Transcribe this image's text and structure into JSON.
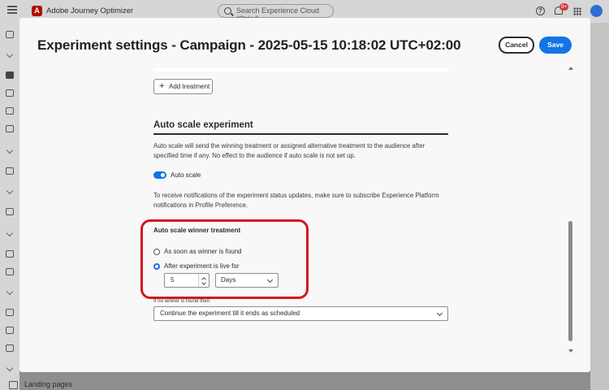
{
  "app": {
    "name": "Adobe Journey Optimizer",
    "logo_letter": "A"
  },
  "search": {
    "placeholder": "Search Experience Cloud (Ctrl+/)"
  },
  "header": {
    "help_glyph": "?",
    "notification_badge": "9+"
  },
  "sidebar": {
    "bottom_item_label": "Landing pages"
  },
  "modal": {
    "title": "Experiment settings - Campaign - 2025-05-15 10:18:02 UTC+02:00",
    "cancel_label": "Cancel",
    "save_label": "Save",
    "add_treatment_label": "Add treatment",
    "plus_glyph": "+",
    "section_title": "Auto scale experiment",
    "description": "Auto scale will send the winning treatment or assigned alternative treatment to the audience after specified time if any. No effect to the audience if auto scale is not set up.",
    "toggle": {
      "label": "Auto scale",
      "on": true
    },
    "notification_text": "To receive notifications of the experiment status updates, make sure to subscribe Experience Platform notifications in Profile Preference.",
    "winner_panel": {
      "title": "Auto scale winner treatment",
      "option_1": "As soon as winner is found",
      "option_2": "After experiment is live for",
      "selected_option": 2,
      "duration_value": "5",
      "duration_unit": "Days"
    },
    "no_winner": {
      "label": "If no winner is found then",
      "value": "Continue the experiment till it ends as scheduled"
    }
  },
  "colors": {
    "accent": "#1473e6",
    "highlight": "#d2171f",
    "brand": "#b30b00"
  }
}
